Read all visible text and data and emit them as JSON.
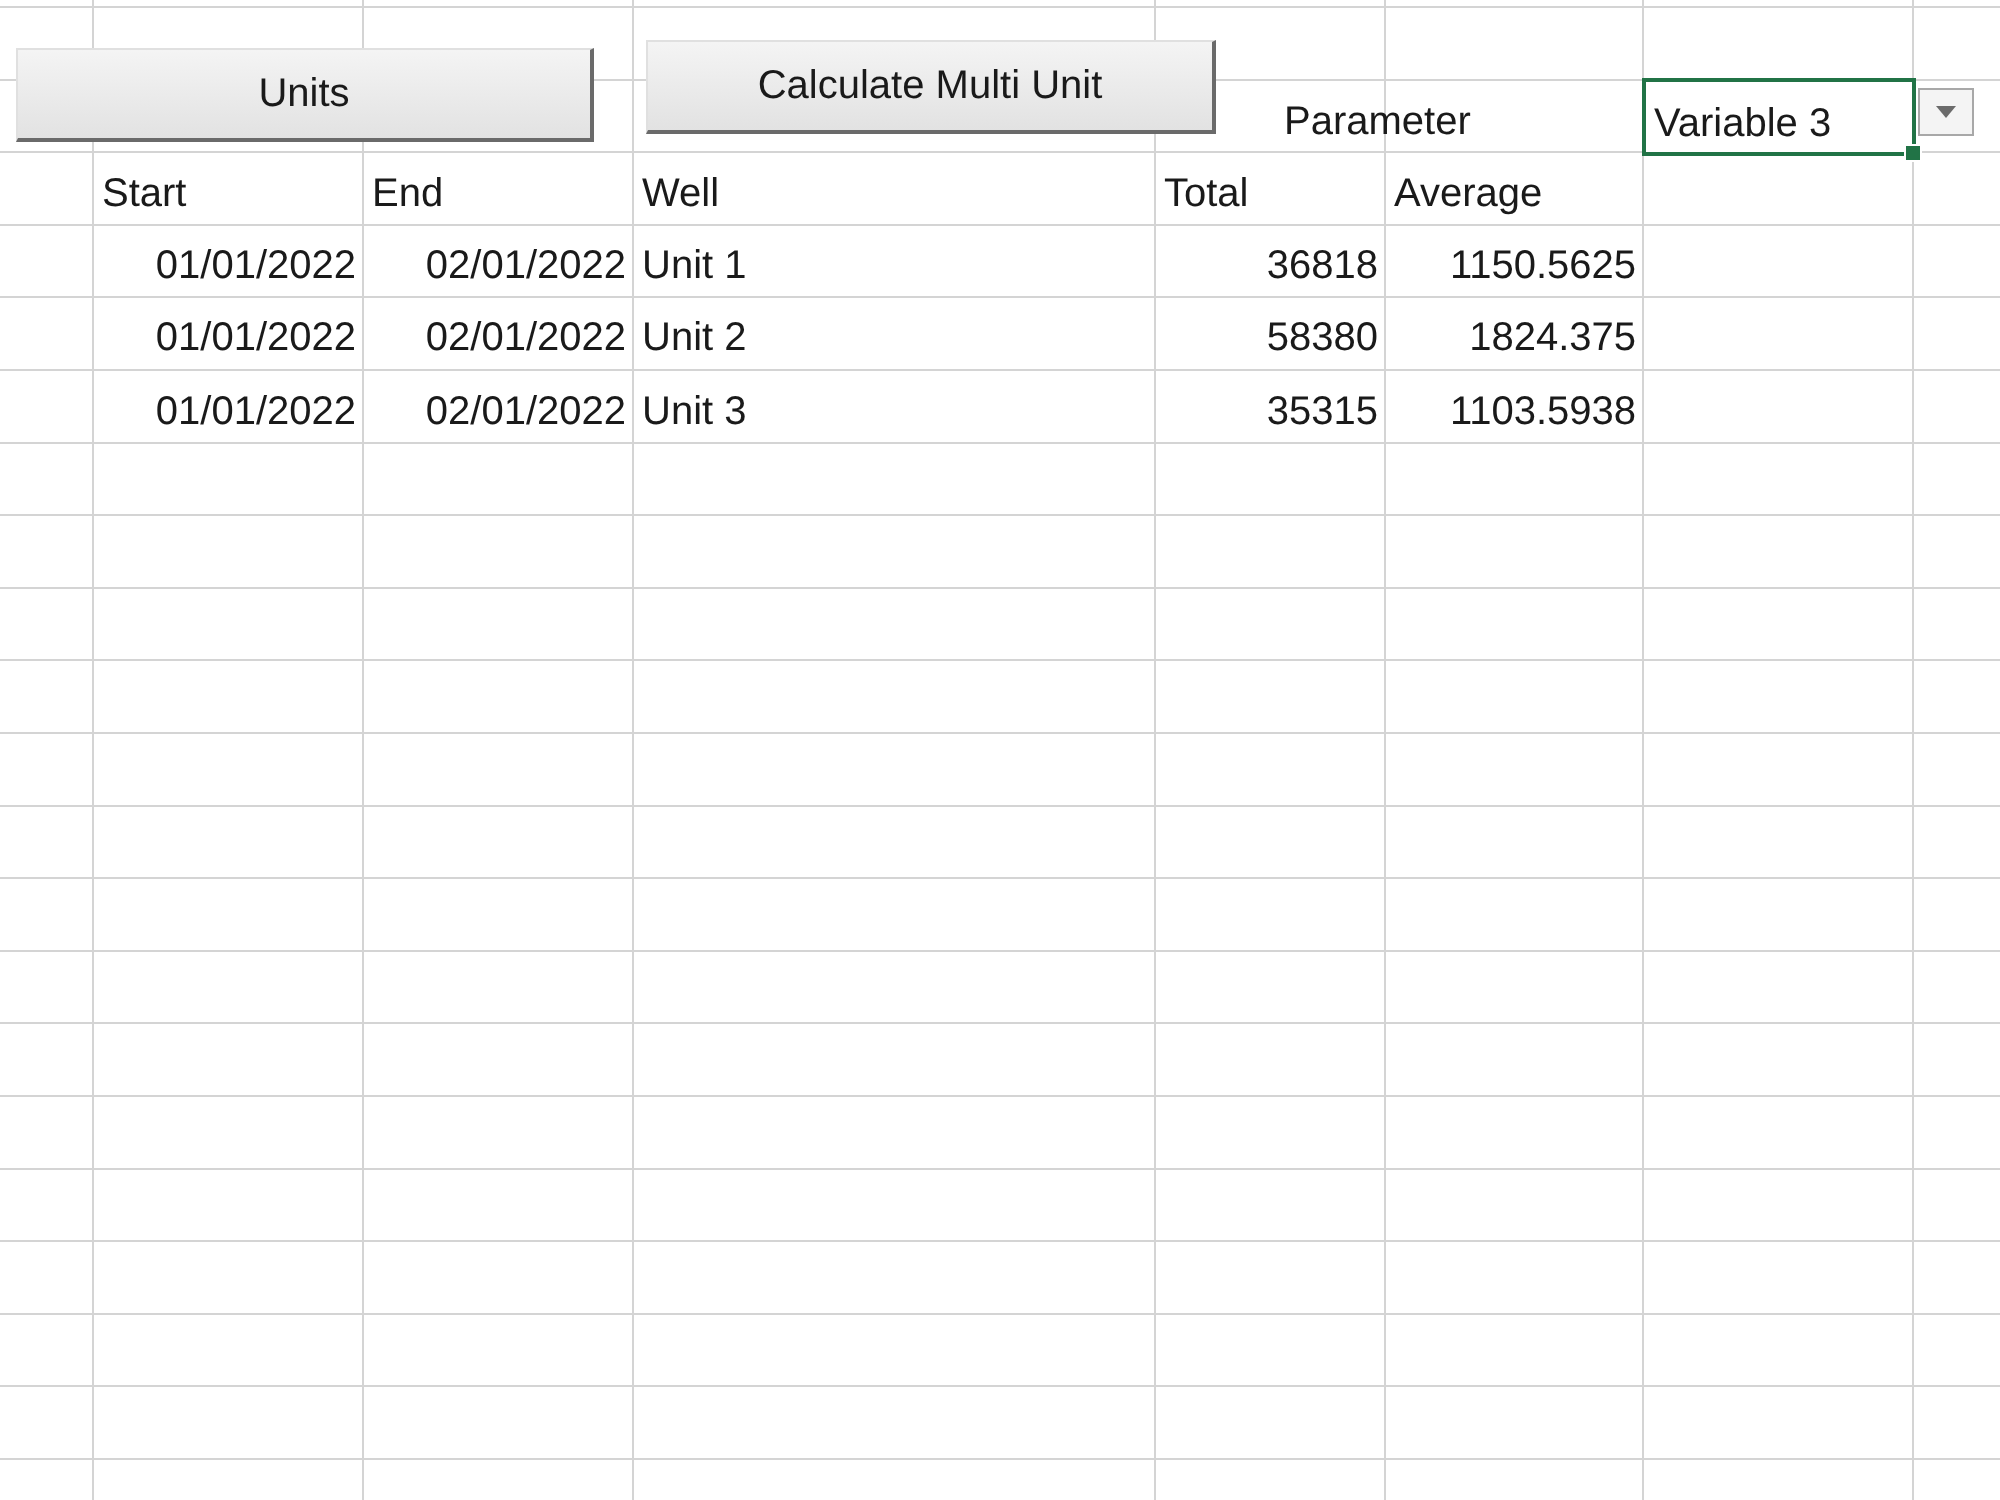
{
  "buttons": [
    {
      "label": "Units"
    },
    {
      "label": "Calculate Multi Unit"
    }
  ],
  "parameter": {
    "label": "Parameter",
    "value": "Variable 3"
  },
  "table": {
    "columns": [
      "Start",
      "End",
      "Well",
      "Total",
      "Average"
    ],
    "rows": [
      [
        "01/01/2022",
        "02/01/2022",
        "Unit 1",
        "36818",
        "1150.5625"
      ],
      [
        "01/01/2022",
        "02/01/2022",
        "Unit 2",
        "58380",
        "1824.375"
      ],
      [
        "01/01/2022",
        "02/01/2022",
        "Unit 3",
        "35315",
        "1103.5938"
      ]
    ]
  }
}
